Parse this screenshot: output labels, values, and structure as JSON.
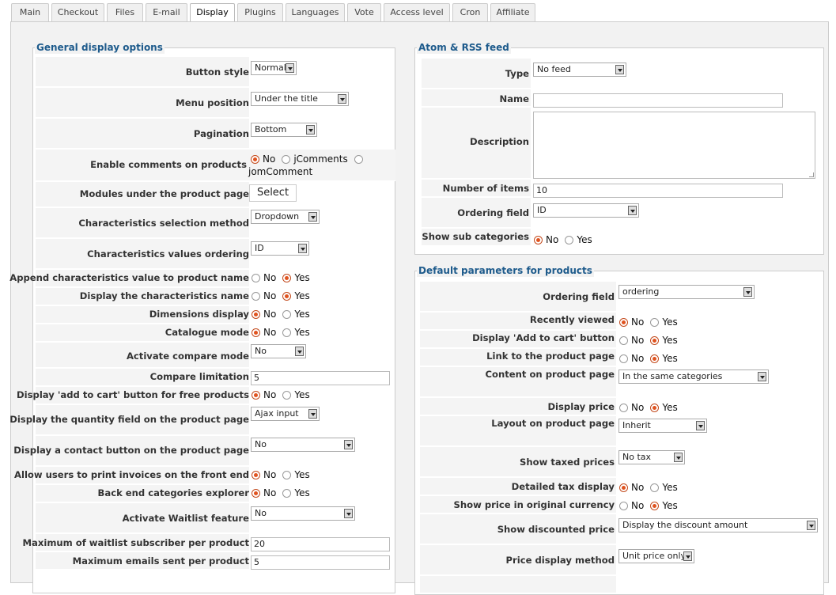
{
  "tabs": [
    "Main",
    "Checkout",
    "Files",
    "E-mail",
    "Display",
    "Plugins",
    "Languages",
    "Vote",
    "Access level",
    "Cron",
    "Affiliate"
  ],
  "active_tab": "Display",
  "general": {
    "legend": "General display options",
    "button_style": {
      "label": "Button style",
      "value": "Normal"
    },
    "menu_position": {
      "label": "Menu position",
      "value": "Under the title"
    },
    "pagination": {
      "label": "Pagination",
      "value": "Bottom"
    },
    "enable_comments": {
      "label": "Enable comments on products",
      "opt1": "No",
      "opt2": "jComments",
      "opt3": "jomComment"
    },
    "modules_under": {
      "label": "Modules under the product page",
      "button": "Select"
    },
    "char_selection": {
      "label": "Characteristics selection method",
      "value": "Dropdown"
    },
    "char_ordering": {
      "label": "Characteristics values ordering",
      "value": "ID"
    },
    "append_char": {
      "label": "Append characteristics value to product name",
      "no": "No",
      "yes": "Yes"
    },
    "display_char_name": {
      "label": "Display the characteristics name",
      "no": "No",
      "yes": "Yes"
    },
    "dimensions": {
      "label": "Dimensions display",
      "no": "No",
      "yes": "Yes"
    },
    "catalogue_mode": {
      "label": "Catalogue mode",
      "no": "No",
      "yes": "Yes"
    },
    "compare_mode": {
      "label": "Activate compare mode",
      "value": "No"
    },
    "compare_limit": {
      "label": "Compare limitation",
      "value": "5"
    },
    "free_cart": {
      "label": "Display 'add to cart' button for free products",
      "no": "No",
      "yes": "Yes"
    },
    "qty_field": {
      "label": "Display the quantity field on the product page",
      "value": "Ajax input"
    },
    "contact_btn": {
      "label": "Display a contact button on the product page",
      "value": "No"
    },
    "print_invoices": {
      "label": "Allow users to print invoices on the front end",
      "no": "No",
      "yes": "Yes"
    },
    "cat_explorer": {
      "label": "Back end categories explorer",
      "no": "No",
      "yes": "Yes"
    },
    "waitlist": {
      "label": "Activate Waitlist feature",
      "value": "No"
    },
    "max_waitlist": {
      "label": "Maximum of waitlist subscriber per product",
      "value": "20"
    },
    "max_emails": {
      "label": "Maximum emails sent per product",
      "value": "5"
    }
  },
  "atom": {
    "legend": "Atom & RSS feed",
    "type": {
      "label": "Type",
      "value": "No feed"
    },
    "name": {
      "label": "Name",
      "value": ""
    },
    "description": {
      "label": "Description"
    },
    "num_items": {
      "label": "Number of items",
      "value": "10"
    },
    "ordering": {
      "label": "Ordering field",
      "value": "ID"
    },
    "sub_cats": {
      "label": "Show sub categories",
      "no": "No",
      "yes": "Yes"
    }
  },
  "defaults": {
    "legend": "Default parameters for products",
    "ordering": {
      "label": "Ordering field",
      "value": "ordering"
    },
    "recently": {
      "label": "Recently viewed",
      "no": "No",
      "yes": "Yes"
    },
    "add_cart": {
      "label": "Display 'Add to cart' button",
      "no": "No",
      "yes": "Yes"
    },
    "link_product": {
      "label": "Link to the product page",
      "no": "No",
      "yes": "Yes"
    },
    "content": {
      "label": "Content on product page",
      "value": "In the same categories"
    },
    "display_price": {
      "label": "Display price",
      "no": "No",
      "yes": "Yes"
    },
    "layout": {
      "label": "Layout on product page",
      "value": "Inherit"
    },
    "taxed": {
      "label": "Show taxed prices",
      "value": "No tax"
    },
    "detailed_tax": {
      "label": "Detailed tax display",
      "no": "No",
      "yes": "Yes"
    },
    "orig_currency": {
      "label": "Show price in original currency",
      "no": "No",
      "yes": "Yes"
    },
    "discounted": {
      "label": "Show discounted price",
      "value": "Display the discount amount"
    },
    "price_method": {
      "label": "Price display method",
      "value": "Unit price only"
    }
  }
}
